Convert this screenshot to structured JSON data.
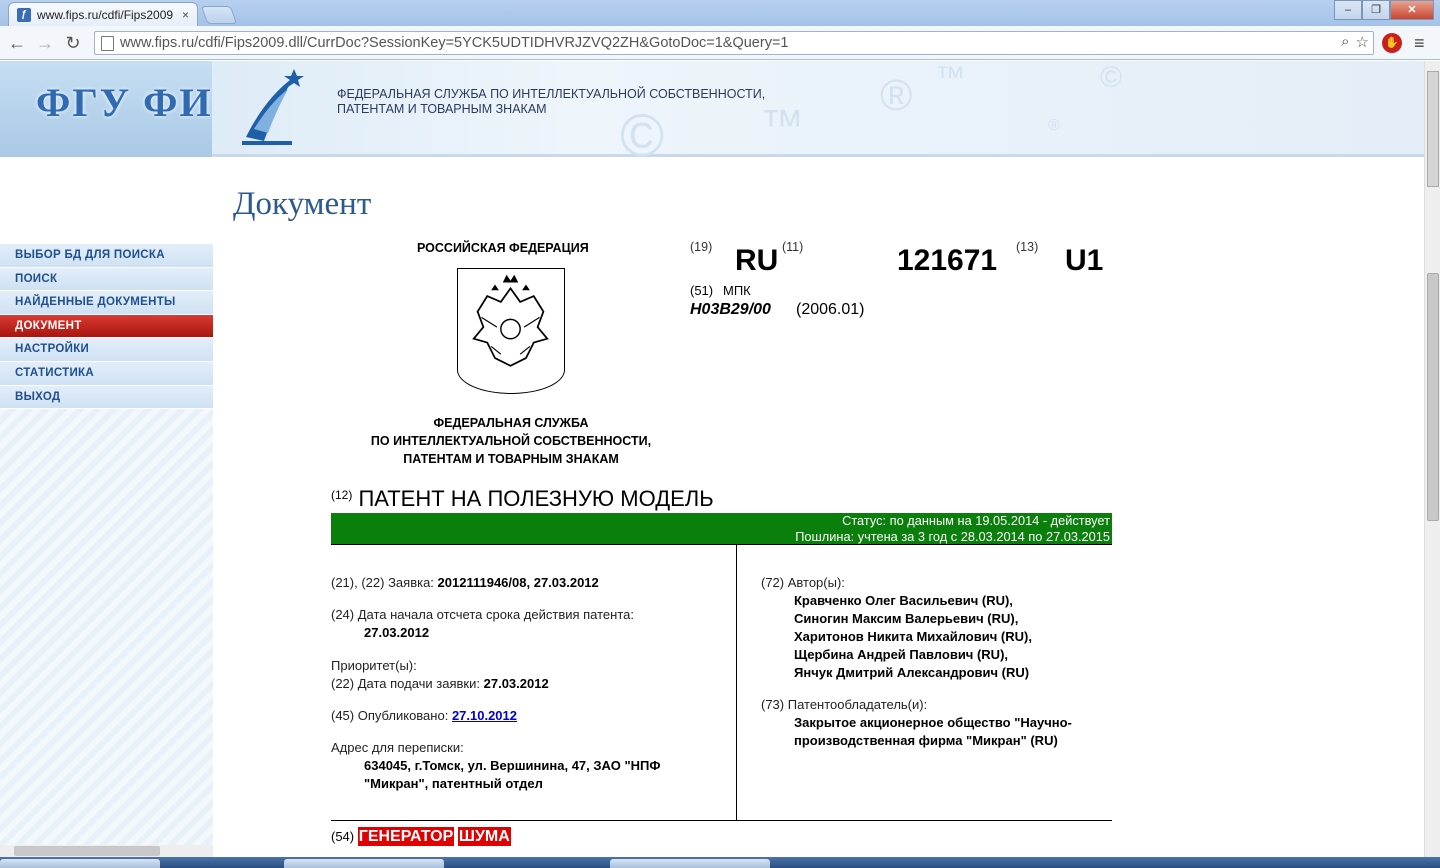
{
  "browser": {
    "tab_title": "www.fips.ru/cdfi/Fips2009",
    "tab_close": "×",
    "url_host": "www.fips.ru",
    "url_path": "/cdfi/Fips2009.dll/CurrDoc?SessionKey=5YCK5UDTIDHVRJZVQ2ZH&GotoDoc=1&Query=1",
    "win_min": "‒",
    "win_max": "❐",
    "win_close": "✕"
  },
  "banner": {
    "logo_text": "ФГУ ФИП",
    "org_line1": "ФЕДЕРАЛЬНАЯ СЛУЖБА ПО ИНТЕЛЛЕКТУАЛЬНОЙ СОБСТВЕННОСТИ,",
    "org_line2": "ПАТЕНТАМ И ТОВАРНЫМ ЗНАКАМ"
  },
  "page_title": "Документ",
  "sidebar": {
    "items": [
      {
        "label": "ВЫБОР БД ДЛЯ ПОИСКА"
      },
      {
        "label": "ПОИСК"
      },
      {
        "label": "НАЙДЕННЫЕ ДОКУМЕНТЫ"
      },
      {
        "label": "ДОКУМЕНТ"
      },
      {
        "label": "НАСТРОЙКИ"
      },
      {
        "label": "СТАТИСТИКА"
      },
      {
        "label": "ВЫХОД"
      }
    ]
  },
  "document": {
    "country_header": "РОССИЙСКАЯ ФЕДЕРАЦИЯ",
    "org_line1": "ФЕДЕРАЛЬНАЯ СЛУЖБА",
    "org_line2": "ПО ИНТЕЛЛЕКТУАЛЬНОЙ СОБСТВЕННОСТИ,",
    "org_line3": "ПАТЕНТАМ И ТОВАРНЫМ ЗНАКАМ",
    "code19": "(19)",
    "country_code": "RU",
    "code11": "(11)",
    "patent_number": "121671",
    "code13": "(13)",
    "kind_code": "U1",
    "code51": "(51)",
    "mpk_label": "МПК",
    "ipc_class": "H03B29/00",
    "ipc_year": "(2006.01)",
    "code12": "(12)",
    "patent_type": "ПАТЕНТ НА ПОЛЕЗНУЮ МОДЕЛЬ",
    "status_line1": "Статус: по данным на 19.05.2014 - действует",
    "status_line2": "Пошлина: учтена за 3 год с 28.03.2014 по 27.03.2015",
    "application_label": "(21), (22) Заявка:",
    "application_value": "2012111946/08, 27.03.2012",
    "term_start_label": "(24) Дата начала отсчета срока действия патента:",
    "term_start_value": "27.03.2012",
    "priority_label": "Приоритет(ы):",
    "filing_date_label": "(22) Дата подачи заявки:",
    "filing_date_value": "27.03.2012",
    "published_label": "(45) Опубликовано:",
    "published_value": "27.10.2012",
    "address_label": "Адрес для переписки:",
    "address_line1": "634045, г.Томск, ул. Вершинина, 47, ЗАО \"НПФ",
    "address_line2": "\"Микран\", патентный отдел",
    "authors_label": "(72) Автор(ы):",
    "authors": [
      "Кравченко Олег Васильевич (RU),",
      "Синогин Максим Валерьевич (RU),",
      "Харитонов Никита Михайлович (RU),",
      "Щербина Андрей Павлович (RU),",
      "Янчук Дмитрий Александрович (RU)"
    ],
    "holder_label": "(73) Патентообладатель(и):",
    "holder_line1": "Закрытое акционерное общество \"Научно-",
    "holder_line2": "производственная фирма \"Микран\" (RU)",
    "code54": "(54)",
    "title_word1": "ГЕНЕРАТОР",
    "title_word2": "ШУМА"
  },
  "colors": {
    "status_bar": "#0b7f0b",
    "active_menu": "#c8201a",
    "title_blue": "#2d5a8e",
    "highlight": "#e00000"
  }
}
